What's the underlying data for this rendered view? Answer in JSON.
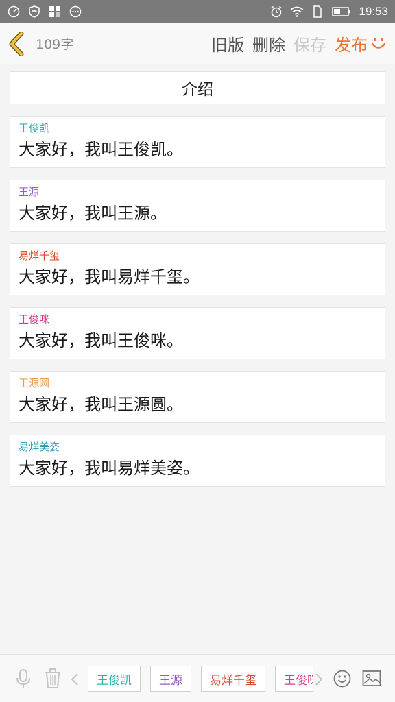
{
  "status_bar": {
    "time": "19:53",
    "left_icons": [
      "speedometer-icon",
      "shield-icon",
      "apps-icon",
      "more-icon"
    ],
    "right_icons": [
      "alarm-icon",
      "wifi-icon",
      "sim-icon",
      "battery-icon"
    ]
  },
  "header": {
    "word_count": "109字",
    "old_label": "旧版",
    "delete_label": "删除",
    "save_label": "保存",
    "publish_label": "发布"
  },
  "title": "介绍",
  "cards": [
    {
      "name": "王俊凯",
      "text": "大家好，我叫王俊凯。",
      "color": "#2ab3b0"
    },
    {
      "name": "王源",
      "text": "大家好，我叫王源。",
      "color": "#9b59c7"
    },
    {
      "name": "易烊千玺",
      "text": "大家好，我叫易烊千玺。",
      "color": "#d9462a"
    },
    {
      "name": "王俊咪",
      "text": "大家好，我叫王俊咪。",
      "color": "#d63d8a"
    },
    {
      "name": "王源圆",
      "text": "大家好，我叫王源圆。",
      "color": "#e99a4e"
    },
    {
      "name": "易烊美姿",
      "text": "大家好，我叫易烊美姿。",
      "color": "#2a9cb8"
    }
  ],
  "chips": [
    {
      "label": "王俊凯",
      "color": "#2ab3b0"
    },
    {
      "label": "王源",
      "color": "#9b59c7"
    },
    {
      "label": "易烊千玺",
      "color": "#d9462a"
    },
    {
      "label": "王俊咪",
      "color": "#d63d8a"
    }
  ],
  "accent_color": "#e8743a"
}
